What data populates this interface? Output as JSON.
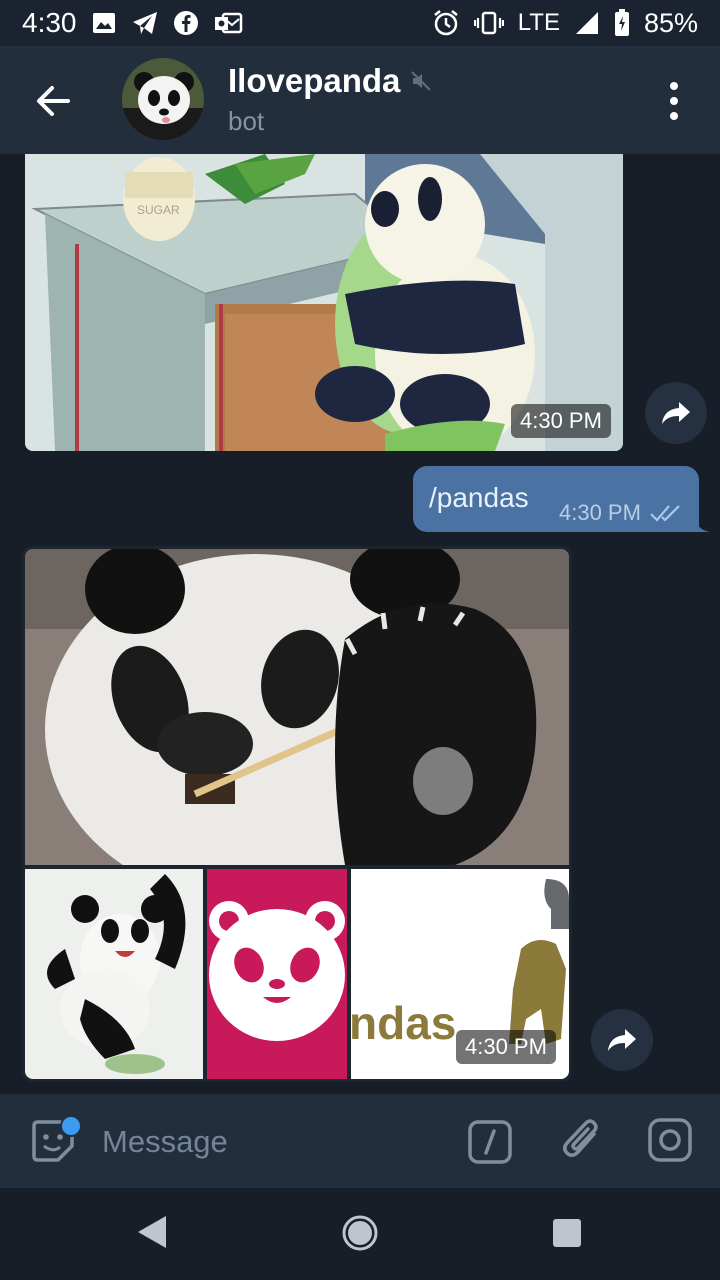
{
  "status_bar": {
    "time": "4:30",
    "network": "LTE",
    "battery": "85%",
    "notification_icons": [
      "gallery-icon",
      "telegram-icon",
      "facebook-icon",
      "outlook-icon"
    ],
    "system_icons": [
      "alarm-icon",
      "vibrate-icon",
      "signal-icon",
      "battery-icon"
    ]
  },
  "header": {
    "title": "Ilovepanda",
    "subtitle": "bot",
    "muted": true
  },
  "messages": [
    {
      "type": "photo",
      "direction": "incoming",
      "time": "4:30 PM",
      "description": "cartoon panda at table"
    },
    {
      "type": "text",
      "direction": "outgoing",
      "text": "/pandas",
      "time": "4:30 PM",
      "status": "read"
    },
    {
      "type": "album",
      "direction": "incoming",
      "time": "4:30 PM",
      "items": [
        "panda eating bamboo",
        "cartoon panda",
        "pink panda logo",
        "pandas logo"
      ],
      "logo_text": "ndas"
    }
  ],
  "composer": {
    "placeholder": "Message",
    "has_notification_dot": true
  },
  "colors": {
    "background": "#171e27",
    "header": "#232e3c",
    "outgoing_bubble": "#4a73a3",
    "accent": "#3a9bef",
    "logo_pink": "#c8195b",
    "logo_olive": "#8c7a3b"
  }
}
